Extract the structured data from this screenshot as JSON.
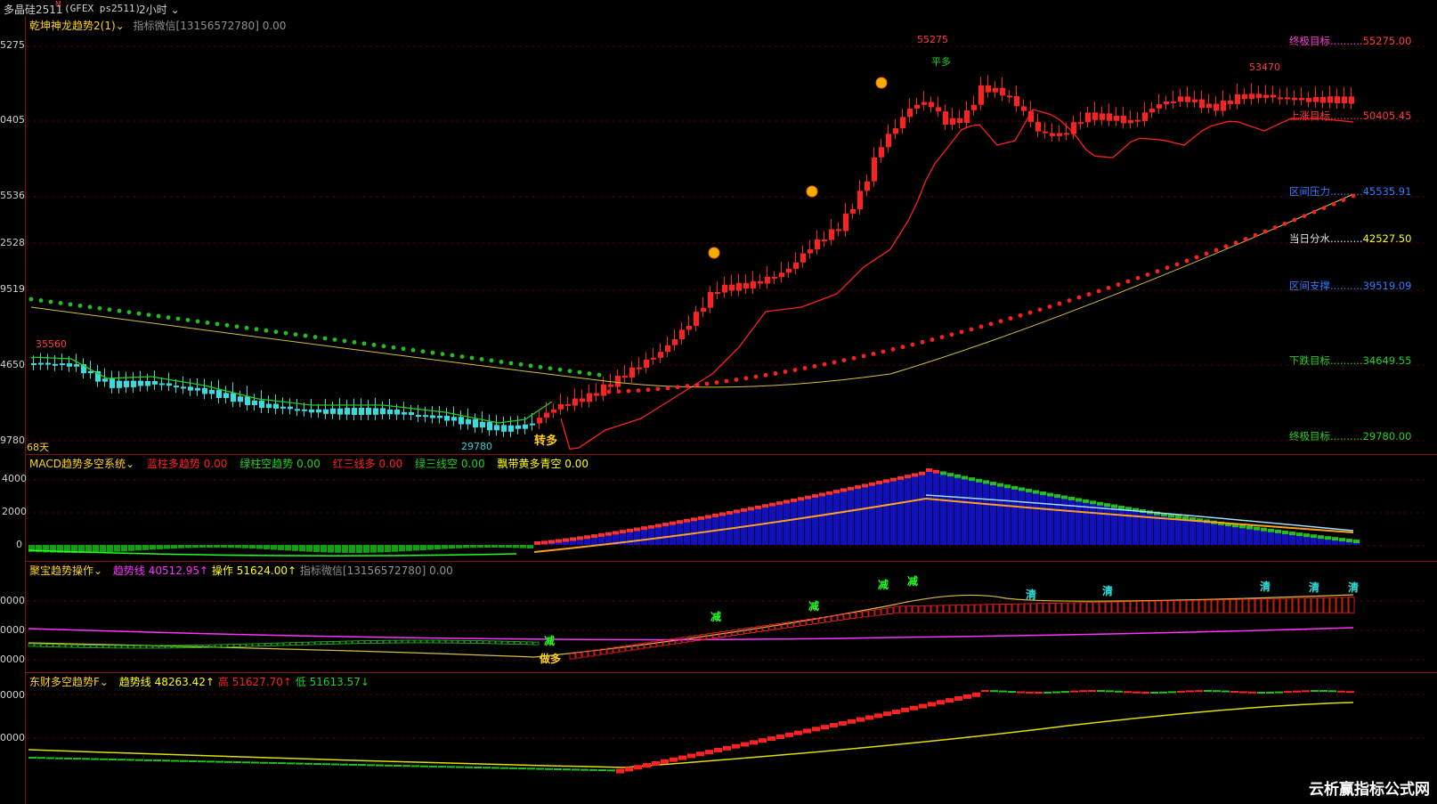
{
  "header": {
    "symbol": "多晶硅2511",
    "m_badge": "M",
    "exchange": "(GFEX ps2511)",
    "period": "2小时"
  },
  "pane1": {
    "name": "乾坤神龙趋势2(1)",
    "wechat": "指标微信[13156572780]",
    "value": "0.00",
    "y_ticks": [
      "5275",
      "0405",
      "5536",
      "2528",
      "9519",
      "4650",
      "9780"
    ],
    "peak_label": "55275",
    "low_label": "35560",
    "right_high": "53470",
    "bottom_low": "29780",
    "days": "68天",
    "signal_zhuanduo": "转多",
    "signal_pingduo": "平多",
    "levels": [
      {
        "name": "终极目标",
        "value": "55275.00",
        "color": "#ff3bd7",
        "vcolor": "#ff3b3b"
      },
      {
        "name": "上涨目标",
        "value": "50405.45",
        "color": "#ff3b3b",
        "vcolor": "#ff3b3b"
      },
      {
        "name": "区间压力",
        "value": "45535.91",
        "color": "#2f7bff",
        "vcolor": "#2f7bff"
      },
      {
        "name": "当日分水",
        "value": "42527.50",
        "color": "#e6e6e6",
        "vcolor": "#ffff00"
      },
      {
        "name": "区间支撑",
        "value": "39519.09",
        "color": "#2f7bff",
        "vcolor": "#2f7bff"
      },
      {
        "name": "下跌目标",
        "value": "34649.55",
        "color": "#20d020",
        "vcolor": "#20d020"
      },
      {
        "name": "终极目标",
        "value": "29780.00",
        "color": "#20d020",
        "vcolor": "#20d020"
      }
    ]
  },
  "pane2": {
    "name": "MACD趋势多空系统",
    "items": [
      {
        "label": "蓝柱多趋势",
        "value": "0.00",
        "color": "#ff2020"
      },
      {
        "label": "绿柱空趋势",
        "value": "0.00",
        "color": "#20d020"
      },
      {
        "label": "红三线多",
        "value": "0.00",
        "color": "#ff2020"
      },
      {
        "label": "绿三线空",
        "value": "0.00",
        "color": "#20d020"
      },
      {
        "label": "飘带黄多青空",
        "value": "0.00",
        "color": "#ffff00"
      }
    ],
    "y_ticks": [
      "4000",
      "2000",
      "0"
    ]
  },
  "pane3": {
    "name": "聚宝趋势操作",
    "trend_label": "趋势线",
    "trend_value": "40512.95",
    "op_label": "操作",
    "op_value": "51624.00",
    "wechat": "指标微信[13156572780]",
    "wechat_value": "0.00",
    "y_ticks": [
      "0000",
      "0000",
      "0000"
    ],
    "signals": {
      "jian": "减",
      "qing": "清",
      "zuoduo": "做多"
    }
  },
  "pane4": {
    "name": "东财多空趋势F",
    "trend_label": "趋势线",
    "trend_value": "48263.42",
    "high_label": "高",
    "high_value": "51627.70",
    "low_label": "低",
    "low_value": "51613.57",
    "y_ticks": [
      "0000",
      "0000"
    ]
  },
  "watermark": "云析赢指标公式网"
}
